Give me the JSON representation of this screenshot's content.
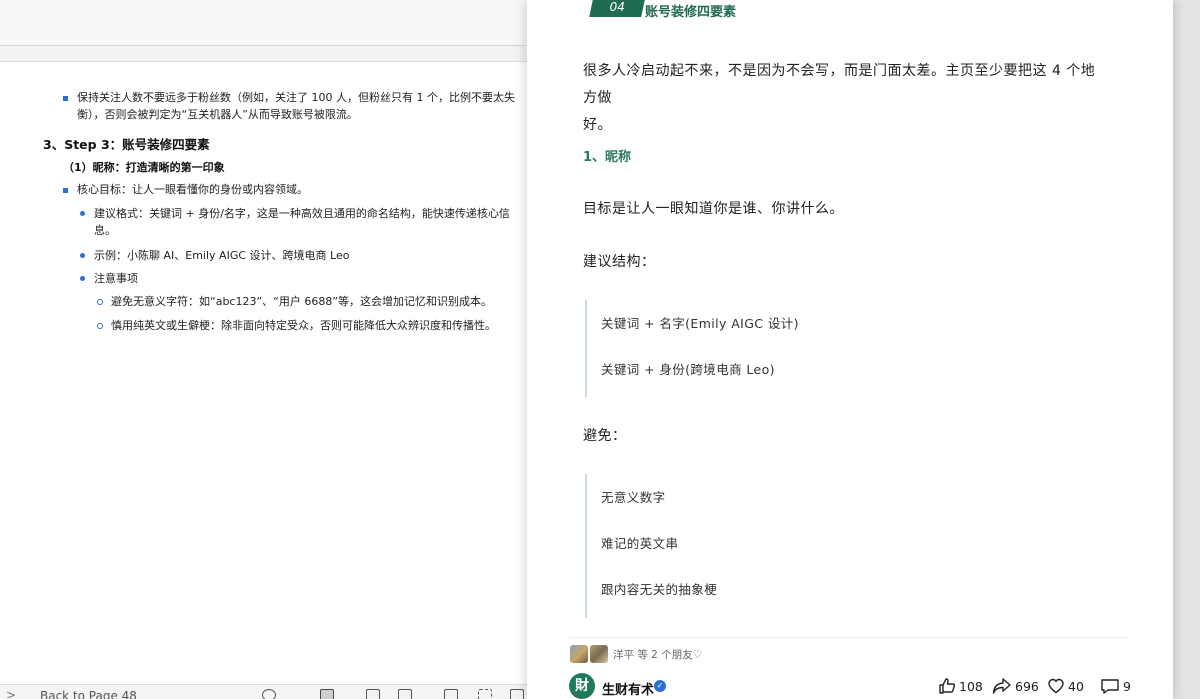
{
  "left_doc": {
    "bullet_follow_ratio_line1": "保持关注人数不要远多于粉丝数（例如，关注了 100 人，但粉丝只有 1 个，比例不要太失",
    "bullet_follow_ratio_line2": "衡），否则会被判定为“互关机器人”从而导致账号被限流。",
    "step3_heading": "3、Step 3：账号装修四要素",
    "nickname_heading": "（1）昵称：打造清晰的第一印象",
    "core_goal": "核心目标：让人一眼看懂你的身份或内容领域。",
    "format_line1": "建议格式：关键词 + 身份/名字，这是一种高效且通用的命名结构，能快速传递核心信",
    "format_line2": "息。",
    "examples": "示例：小陈聊 AI、Emily AIGC 设计、跨境电商 Leo",
    "notes_heading": "注意事项",
    "note1": "避免无意义字符：如“abc123”、“用户 6688”等，这会增加记忆和识别成本。",
    "note2": "慎用纯英文或生僻梗：除非面向特定受众，否则可能降低大众辨识度和传播性。"
  },
  "left_status": {
    "chevron": ">",
    "back_label": "Back to Page 48"
  },
  "article": {
    "section_number": "04",
    "section_title": "账号装修四要素",
    "intro_line1": "很多人冷启动起不来，不是因为不会写，而是门面太差。主页至少要把这 4 个地方做",
    "intro_line2": "好。",
    "subhead_nickname": "1、昵称",
    "goal": "目标是让人一眼知道你是谁、你讲什么。",
    "suggest_label": "建议结构：",
    "suggest_items": [
      "关键词 + 名字(Emily AIGC 设计)",
      "关键词 + 身份(跨境电商 Leo)"
    ],
    "avoid_label": "避免：",
    "avoid_items": [
      "无意义数字",
      "难记的英文串",
      "跟内容无关的抽象梗"
    ]
  },
  "footer": {
    "friends_text": "洋平 等 2 个朋友♡",
    "account_logo_char": "財",
    "account_name": "生财有术",
    "likes": "108",
    "shares": "696",
    "favorites": "40",
    "comments": "9"
  },
  "colors": {
    "accent_green": "#1f6b53",
    "bullet_blue": "#2b6fd6"
  }
}
